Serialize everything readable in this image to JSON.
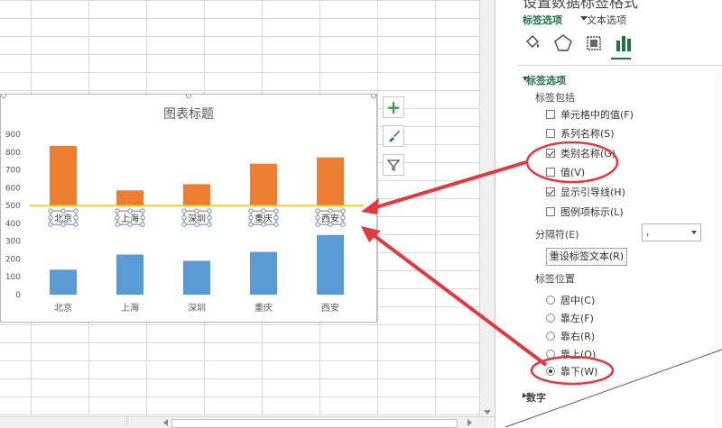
{
  "pane": {
    "title": "设置数据标签格式",
    "tab_label_options": "标签选项",
    "tab_text_options": "文本选项",
    "icons": [
      "fill-bucket-icon",
      "pentagon-icon",
      "size-properties-icon",
      "bar-chart-options-icon"
    ],
    "section_label_options": "标签选项",
    "label_contains_heading": "标签包括",
    "contains_options": [
      {
        "label": "单元格中的值(F)",
        "checked": false
      },
      {
        "label": "系列名称(S)",
        "checked": false
      },
      {
        "label": "类别名称(G)",
        "checked": true
      },
      {
        "label": "值(V)",
        "checked": false
      },
      {
        "label": "显示引导线(H)",
        "checked": true
      },
      {
        "label": "图例项标示(L)",
        "checked": false
      }
    ],
    "separator_label": "分隔符(E)",
    "separator_value": ",",
    "reset_button": "重设标签文本(R)",
    "label_position_heading": "标签位置",
    "position_options": [
      {
        "label": "居中(C)",
        "checked": false
      },
      {
        "label": "靠左(F)",
        "checked": false
      },
      {
        "label": "靠右(R)",
        "checked": false
      },
      {
        "label": "靠上(O)",
        "checked": false
      },
      {
        "label": "靠下(W)",
        "checked": true
      }
    ],
    "section_number": "数字"
  },
  "colors": {
    "orange": "#ed7d31",
    "blue": "#5b9bd5",
    "threshold_line": "#ffc000",
    "accent_green": "#217346",
    "annotation_red": "#e0393e"
  },
  "chart_data": {
    "type": "bar",
    "title": "图表标题",
    "categories": [
      "北京",
      "上海",
      "深圳",
      "重庆",
      "西安"
    ],
    "series": [
      {
        "values": [
          140,
          225,
          190,
          240,
          335
        ]
      },
      {
        "values": [
          835,
          585,
          620,
          735,
          770
        ]
      }
    ],
    "threshold": 500,
    "ylim": [
      0,
      900
    ],
    "yticks": [
      0,
      100,
      200,
      300,
      400,
      500,
      600,
      700,
      800,
      900
    ],
    "data_labels": [
      "北京",
      "上海",
      "深圳",
      "重庆",
      "西安"
    ],
    "xlabel": "",
    "ylabel": ""
  }
}
